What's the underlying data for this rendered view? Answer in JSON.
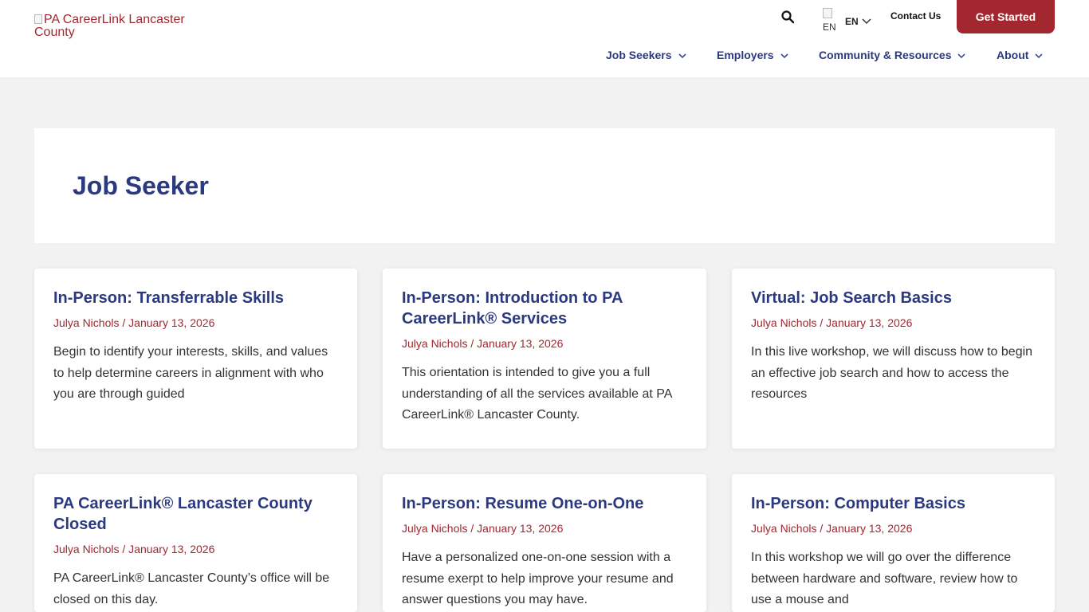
{
  "header": {
    "logo_alt": "PA CareerLink Lancaster County",
    "search_icon": "search-icon",
    "language": {
      "flag_alt": "EN",
      "code": "EN"
    },
    "contact_label": "Contact Us",
    "cta_label": "Get Started"
  },
  "nav": {
    "items": [
      {
        "label": "Job Seekers"
      },
      {
        "label": "Employers"
      },
      {
        "label": "Community & Resources"
      },
      {
        "label": "About"
      }
    ]
  },
  "page": {
    "title": "Job Seeker"
  },
  "posts": [
    {
      "title": "In-Person: Transferrable Skills",
      "author": "Julya Nichols",
      "separator": " / ",
      "date": "January 13, 2026",
      "excerpt": "Begin to identify your interests, skills, and values to help determine careers in alignment with who you are through guided"
    },
    {
      "title": "In-Person: Introduction to PA CareerLink® Services",
      "author": "Julya Nichols",
      "separator": " / ",
      "date": "January 13, 2026",
      "excerpt": "This orientation is intended to give you a full understanding of all the services available at PA CareerLink® Lancaster County."
    },
    {
      "title": "Virtual: Job Search Basics",
      "author": "Julya Nichols",
      "separator": " / ",
      "date": "January 13, 2026",
      "excerpt": "In this live workshop, we will discuss how to begin an effective job search and how to access the resources"
    },
    {
      "title": "PA CareerLink® Lancaster County Closed",
      "author": "Julya Nichols",
      "separator": " / ",
      "date": "January 13, 2026",
      "excerpt": "PA CareerLink® Lancaster County’s office will be closed on this day."
    },
    {
      "title": "In-Person: Resume One-on-One",
      "author": "Julya Nichols",
      "separator": " / ",
      "date": "January 13, 2026",
      "excerpt": "Have a personalized one-on-one session with a resume exerpt to help improve your resume and answer questions you may have."
    },
    {
      "title": "In-Person: Computer Basics",
      "author": "Julya Nichols",
      "separator": " / ",
      "date": "January 13, 2026",
      "excerpt": "In this workshop we will go over the difference between hardware and software, review how to use a mouse and"
    }
  ],
  "colors": {
    "brand_blue": "#2b3a80",
    "brand_red": "#a3272f",
    "page_bg": "#f2f2f2"
  }
}
